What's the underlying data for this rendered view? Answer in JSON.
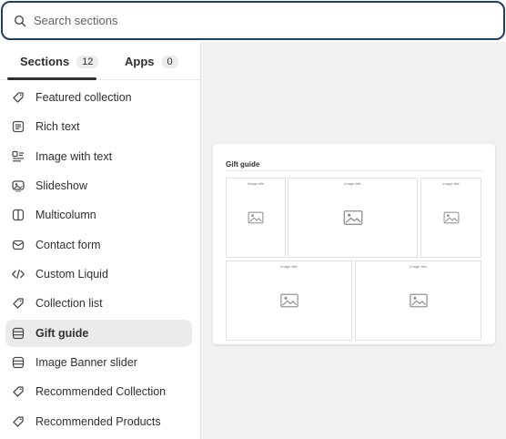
{
  "search": {
    "placeholder": "Search sections",
    "icon": "search-icon"
  },
  "tabs": [
    {
      "label": "Sections",
      "count": "12",
      "active": true
    },
    {
      "label": "Apps",
      "count": "0",
      "active": false
    }
  ],
  "items": [
    {
      "label": "Featured collection",
      "icon": "tag-icon"
    },
    {
      "label": "Rich text",
      "icon": "text-block-icon"
    },
    {
      "label": "Image with text",
      "icon": "image-with-text-icon"
    },
    {
      "label": "Slideshow",
      "icon": "slideshow-icon"
    },
    {
      "label": "Multicolumn",
      "icon": "columns-icon"
    },
    {
      "label": "Contact form",
      "icon": "envelope-icon"
    },
    {
      "label": "Custom Liquid",
      "icon": "code-icon"
    },
    {
      "label": "Collection list",
      "icon": "tag-icon"
    },
    {
      "label": "Gift guide",
      "icon": "list-icon",
      "active": true
    },
    {
      "label": "Image Banner slider",
      "icon": "list-icon"
    },
    {
      "label": "Recommended Collection",
      "icon": "tag-icon"
    },
    {
      "label": "Recommended Products",
      "icon": "tag-icon"
    }
  ],
  "preview": {
    "title": "Gift guide",
    "image_title": "Image title",
    "colors": {
      "focus_border": "#1f3d6b",
      "canvas": "#f1f1f1",
      "active_item": "#ebebeb"
    }
  }
}
